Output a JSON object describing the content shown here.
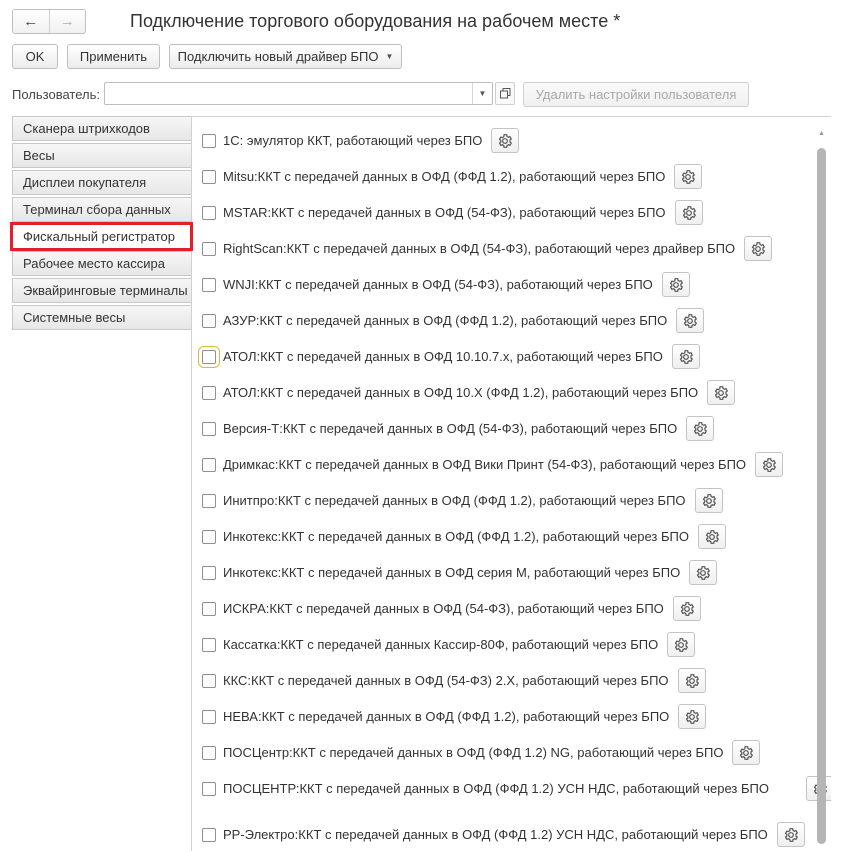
{
  "window": {
    "title": "Подключение торгового оборудования на рабочем месте *",
    "back_icon": "←",
    "forward_icon": "→"
  },
  "toolbar": {
    "ok_label": "OK",
    "apply_label": "Применить",
    "connect_driver_label": "Подключить новый драйвер БПО",
    "connect_caret": "▼"
  },
  "user": {
    "label": "Пользователь:",
    "value": "",
    "dropdown_icon": "▼",
    "delete_settings_label": "Удалить настройки пользователя"
  },
  "tabs": [
    {
      "label": "Сканера штрихкодов"
    },
    {
      "label": "Весы"
    },
    {
      "label": "Дисплеи покупателя"
    },
    {
      "label": "Терминал сбора данных"
    },
    {
      "label": "Фискальный регистратор",
      "active": true
    },
    {
      "label": "Рабочее место кассира"
    },
    {
      "label": "Эквайринговые терминалы"
    },
    {
      "label": "Системные весы"
    }
  ],
  "drivers": [
    {
      "label": "1С: эмулятор ККТ, работающий через БПО",
      "checked": false
    },
    {
      "label": "Mitsu:ККТ с передачей данных в ОФД (ФФД 1.2), работающий через БПО",
      "checked": false
    },
    {
      "label": "MSTAR:ККТ с передачей данных в ОФД (54-ФЗ), работающий через БПО",
      "checked": false
    },
    {
      "label": "RightScan:ККТ с передачей данных в ОФД (54-ФЗ), работающий через драйвер БПО",
      "checked": false
    },
    {
      "label": "WNJI:ККТ с передачей данных в ОФД (54-ФЗ), работающий через БПО",
      "checked": false
    },
    {
      "label": "АЗУР:ККТ с передачей данных в ОФД (ФФД 1.2), работающий через БПО",
      "checked": false
    },
    {
      "label": "АТОЛ:ККТ с передачей данных в ОФД 10.10.7.x, работающий через БПО",
      "checked": false,
      "focused": true
    },
    {
      "label": "АТОЛ:ККТ с передачей данных в ОФД 10.X (ФФД 1.2), работающий через БПО",
      "checked": false
    },
    {
      "label": "Версия-Т:ККТ с передачей данных в ОФД (54-ФЗ), работающий через БПО",
      "checked": false
    },
    {
      "label": "Дримкас:ККТ с передачей данных в ОФД Вики Принт (54-ФЗ), работающий через БПО",
      "checked": false
    },
    {
      "label": "Инитпро:ККТ с передачей данных в ОФД (ФФД 1.2), работающий через БПО",
      "checked": false
    },
    {
      "label": "Инкотекс:ККТ с передачей данных в ОФД (ФФД 1.2), работающий через БПО",
      "checked": false
    },
    {
      "label": "Инкотекс:ККТ с передачей данных в ОФД серия М, работающий через БПО",
      "checked": false
    },
    {
      "label": "ИСКРА:ККТ с передачей данных в ОФД (54-ФЗ), работающий через БПО",
      "checked": false
    },
    {
      "label": "Кассатка:ККТ с передачей данных Кассир-80Ф, работающий через БПО",
      "checked": false
    },
    {
      "label": "ККС:ККТ с передачей данных в ОФД (54-ФЗ) 2.X, работающий через БПО",
      "checked": false
    },
    {
      "label": "НЕВА:ККТ с передачей данных в ОФД (ФФД 1.2), работающий через БПО",
      "checked": false
    },
    {
      "label": "ПОСЦентр:ККТ с передачей данных в ОФД  (ФФД 1.2) NG, работающий через БПО",
      "checked": false
    },
    {
      "label": "ПОСЦЕНТР:ККТ с передачей данных в ОФД  (ФФД 1.2) УСН НДС, работающий через БПО",
      "checked": false,
      "wrap": true
    },
    {
      "label": "PP-Электро:ККТ с передачей данных в ОФД (ФФД 1.2) УСН НДС, работающий через БПО",
      "checked": false
    }
  ],
  "icons": {
    "settings": "gear-icon",
    "scroll_up": "▲"
  },
  "colors": {
    "active_tab_highlight": "#e3202a",
    "focus_outline": "#e2b53c",
    "scrollbar_thumb": "#b5b5b5"
  }
}
